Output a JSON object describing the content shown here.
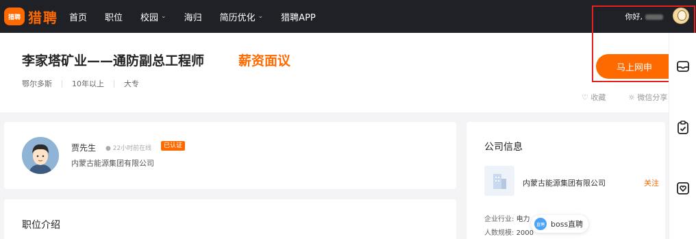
{
  "nav": {
    "logo_badge": "猎聘",
    "logo_text": "猎聘",
    "items": [
      {
        "label": "首页",
        "dropdown": false
      },
      {
        "label": "职位",
        "dropdown": false
      },
      {
        "label": "校园",
        "dropdown": true
      },
      {
        "label": "海归",
        "dropdown": false
      },
      {
        "label": "简历优化",
        "dropdown": true
      },
      {
        "label": "猎聘APP",
        "dropdown": false
      }
    ],
    "greeting": "你好,"
  },
  "job": {
    "title": "李家塔矿业——通防副总工程师",
    "salary": "薪资面议",
    "location": "鄂尔多斯",
    "experience": "10年以上",
    "education": "大专",
    "apply_label": "马上网申",
    "favorite_label": "收藏",
    "share_label": "微信分享"
  },
  "recruiter": {
    "name": "贾先生",
    "online": "22小时前在线",
    "badge": "已认证",
    "company": "内蒙古能源集团有限公司"
  },
  "intro": {
    "title": "职位介绍"
  },
  "company": {
    "section_title": "公司信息",
    "name": "内蒙古能源集团有限公司",
    "follow_label": "关注",
    "industry_label": "企业行业:",
    "industry_value": "电力",
    "size_label": "人数规模:",
    "size_value": "2000"
  },
  "boss_chip": {
    "icon_text": "直聘",
    "label": "boss直聘"
  },
  "colors": {
    "accent": "#ff6a00",
    "nav_bg": "#1f2127",
    "highlight_border": "#e52020"
  }
}
